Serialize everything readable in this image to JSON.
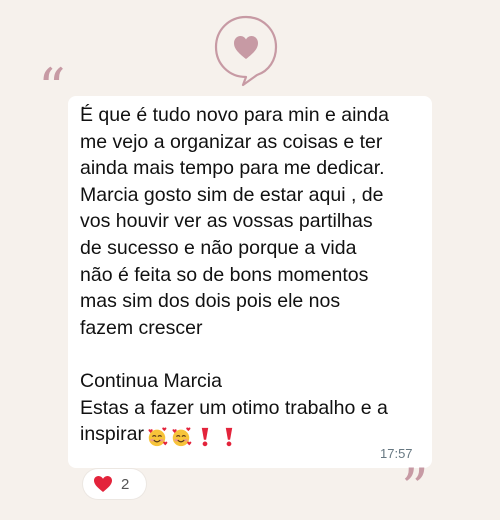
{
  "icons": {
    "header": "speech-bubble-heart-icon",
    "open_quote": "quote-open-icon",
    "close_quote": "quote-close-icon"
  },
  "colors": {
    "background": "#f6f1ec",
    "accent_pink": "#c79aa4",
    "bubble": "#ffffff",
    "text": "#111111",
    "timestamp": "#667781",
    "heart_red": "#e3233b"
  },
  "quotes": {
    "open": "“",
    "close": "”"
  },
  "message": {
    "dot": ".",
    "lines": [
      "É que é tudo novo para min e ainda",
      "me vejo a organizar as coisas e ter",
      "ainda mais tempo para me dedicar.",
      "Marcia gosto sim de estar aqui , de",
      "vos houvir ver as vossas partilhas",
      "de sucesso e não porque a vida",
      "não é feita so de bons momentos",
      "mas sim dos dois pois ele nos",
      "fazem crescer",
      "",
      "Continua Marcia",
      "Estas a fazer um otimo trabalho e a",
      "inspirar"
    ],
    "emojis": [
      "smiling-face-with-hearts",
      "smiling-face-with-hearts",
      "red-exclamation",
      "red-exclamation"
    ],
    "time": "17:57"
  },
  "reaction": {
    "emoji": "red-heart",
    "count": "2"
  }
}
